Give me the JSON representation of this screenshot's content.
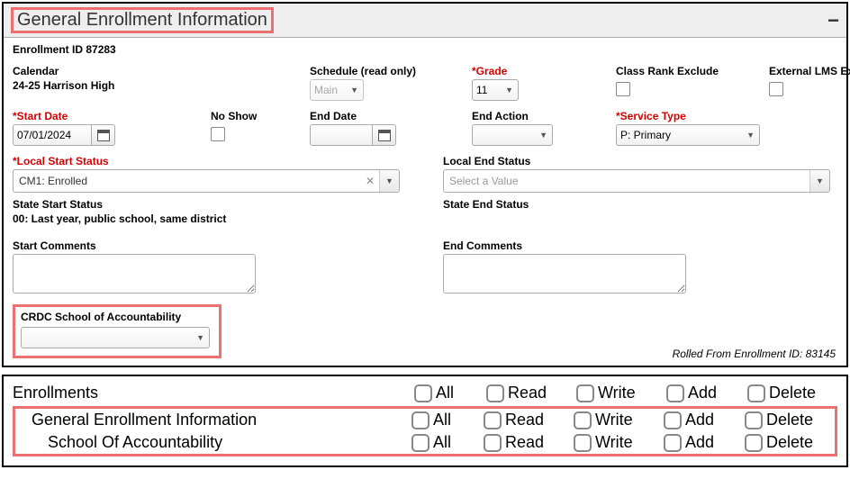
{
  "header": {
    "title": "General Enrollment Information",
    "collapse": "−"
  },
  "enroll_id_label": "Enrollment ID 87283",
  "row1": {
    "calendar_label": "Calendar",
    "calendar_value": "24-25 Harrison High",
    "schedule_label": "Schedule (read only)",
    "schedule_value": "Main",
    "grade_label": "*Grade",
    "grade_value": "11",
    "cre_label": "Class Rank Exclude",
    "lms_label": "External LMS Exclude"
  },
  "row2": {
    "start_date_label": "*Start Date",
    "start_date_value": "07/01/2024",
    "no_show_label": "No Show",
    "end_date_label": "End Date",
    "end_date_value": "",
    "end_action_label": "End Action",
    "end_action_value": "",
    "service_type_label": "*Service Type",
    "service_type_value": "P: Primary"
  },
  "row3": {
    "local_start_label": "*Local Start Status",
    "local_start_value": "CM1: Enrolled",
    "local_end_label": "Local End Status",
    "local_end_placeholder": "Select a Value"
  },
  "row4": {
    "state_start_label": "State Start Status",
    "state_start_value": "00: Last year, public school, same district",
    "state_end_label": "State End Status"
  },
  "comments": {
    "start_label": "Start Comments",
    "end_label": "End Comments"
  },
  "crdc": {
    "label": "CRDC School of Accountability",
    "value": ""
  },
  "rolled_text": "Rolled From Enrollment ID: 83145",
  "perm": {
    "cols": {
      "all": "All",
      "read": "Read",
      "write": "Write",
      "add": "Add",
      "delete": "Delete"
    },
    "rows": [
      {
        "label": "Enrollments"
      },
      {
        "label": "General Enrollment Information"
      },
      {
        "label": "School Of Accountability"
      }
    ]
  }
}
